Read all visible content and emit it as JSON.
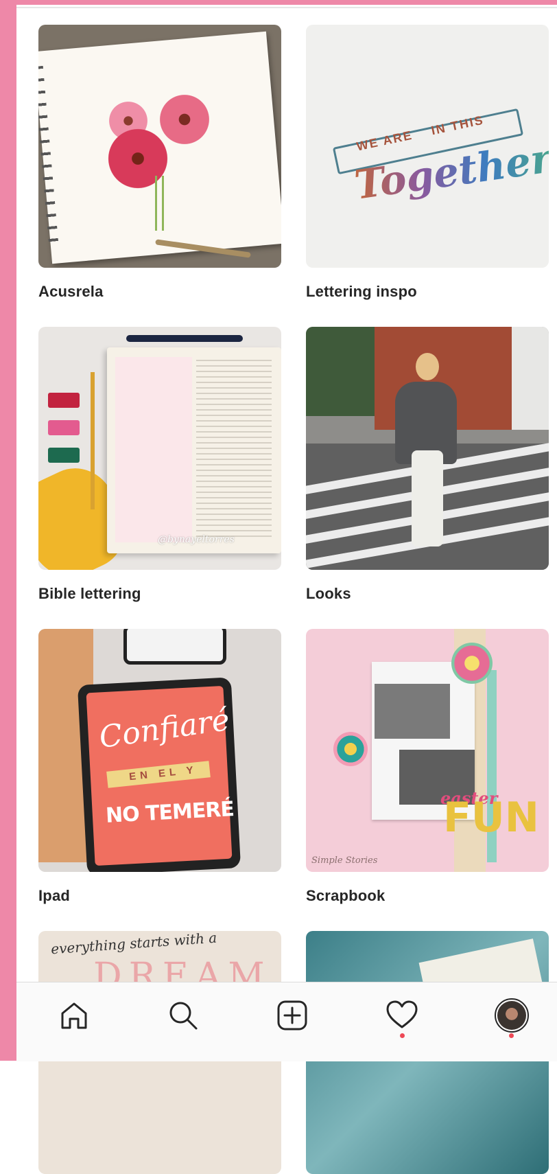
{
  "collections": [
    {
      "id": "c1",
      "label": "Acusrela"
    },
    {
      "id": "c2",
      "label": "Lettering inspo"
    },
    {
      "id": "c3",
      "label": "Bible lettering"
    },
    {
      "id": "c4",
      "label": "Looks"
    },
    {
      "id": "c5",
      "label": "Ipad"
    },
    {
      "id": "c6",
      "label": "Scrapbook"
    }
  ],
  "thumb_text": {
    "lettering_small_left": "WE ARE",
    "lettering_small_right": "IN THIS",
    "lettering_script": "Together",
    "bible_signature": "@bynayeltorres",
    "ipad_word1": "Confiaré",
    "ipad_band": "EN EL Y",
    "ipad_word2": "NO TEMERÉ",
    "scrap_easter": "easter",
    "scrap_fun": "FUN",
    "scrap_footer": "Simple Stories",
    "partial_script": "everything starts with a",
    "partial_big": "DREAM"
  },
  "tab_bar": {
    "items": [
      {
        "name": "home",
        "icon": "home-icon"
      },
      {
        "name": "search",
        "icon": "search-icon"
      },
      {
        "name": "create",
        "icon": "plus-square-icon"
      },
      {
        "name": "activity",
        "icon": "heart-icon",
        "notification": true
      },
      {
        "name": "profile",
        "icon": "avatar",
        "notification": true
      }
    ],
    "notification_color": "#ed4956"
  },
  "colors": {
    "frame_pink": "#ee88a8",
    "text": "#262626",
    "tab_bar_bg": "#fafafa"
  }
}
